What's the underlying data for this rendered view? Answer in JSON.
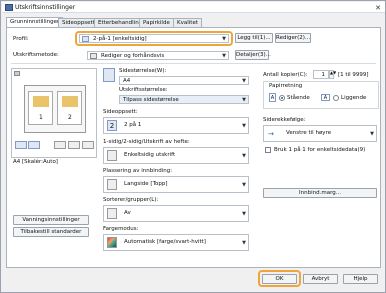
{
  "window": {
    "title": "Utskriftsinnstillinger",
    "close_glyph": "✕"
  },
  "tabs": [
    {
      "label": "Grunninnstillinger",
      "active": true
    },
    {
      "label": "Sideoppsett",
      "active": false
    },
    {
      "label": "Etterbehandling",
      "active": false
    },
    {
      "label": "Papirkilde",
      "active": false
    },
    {
      "label": "Kvalitet",
      "active": false
    }
  ],
  "profile": {
    "label": "Profil:",
    "value": "2-på-1 [enkeltsidig]",
    "add_button": "Legg til(1)...",
    "edit_button": "Rediger(2)..."
  },
  "output_method": {
    "label": "Utskriftsmetode:",
    "value": "Rediger og forhåndsvis",
    "details_button": "Detaljer(3)..."
  },
  "preview": {
    "page_left_number": "1",
    "page_right_number": "2",
    "caption": "A4 [Skalér:Auto]",
    "view_buttons": [
      "layout-view",
      "paper-view"
    ]
  },
  "left_buttons": {
    "watermark": "Vanningsinnstillinger",
    "restore": "Tilbakestill standarder"
  },
  "page_size": {
    "label": "Sidestørrelse(W):",
    "value": "A4"
  },
  "output_size": {
    "label": "Utskriftsstørrelse:",
    "value": "Tilpass sidestørrelse"
  },
  "copies": {
    "label": "Antall kopier(C):",
    "value": "1",
    "range": "[1 til 9999]"
  },
  "orientation": {
    "label": "Papirretning",
    "portrait": "Stående",
    "landscape": "Liggende",
    "selected": "portrait"
  },
  "page_layout": {
    "label": "Sideoppsett:",
    "value": "2 på 1",
    "icon_text": "2"
  },
  "page_order": {
    "label": "Siderekkefølge:",
    "value": "Venstre til høyre"
  },
  "duplex": {
    "label": "1-sidig/2-sidig/Utskrift av hefte:",
    "value": "Enkeltsidig utskrift"
  },
  "rotate": {
    "label": "Bruk 1 på 1 for enkeltsidedata(9)",
    "checked": false
  },
  "binding": {
    "label": "Plassering av innbinding:",
    "value": "Langside [Topp]",
    "margin_button": "Innbind.marg..."
  },
  "sorter": {
    "label": "Sorterer/grupper(L):",
    "value": "Av"
  },
  "color_mode": {
    "label": "Fargemodus:",
    "value": "Automatisk [farge/svart-hvitt]"
  },
  "footer": {
    "ok": "OK",
    "cancel": "Avbryt",
    "help": "Hjelp"
  },
  "colors": {
    "highlight": "#f0a53b",
    "accent": "#1f5fbf"
  }
}
